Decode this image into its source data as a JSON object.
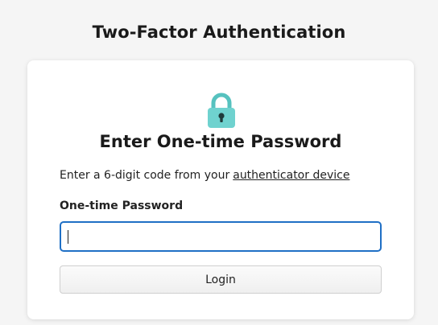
{
  "page": {
    "title": "Two-Factor Authentication"
  },
  "card": {
    "icon": "lock-icon",
    "heading": "Enter One-time Password",
    "instruction_text": "Enter a 6-digit code from your",
    "instruction_link": "authenticator device",
    "field_label": "One-time Password",
    "input_value": "",
    "input_placeholder": "",
    "login_label": "Login"
  },
  "colors": {
    "accent": "#1f6fc5",
    "lock_body": "#6fd2cf",
    "background": "#f5f5f5"
  }
}
